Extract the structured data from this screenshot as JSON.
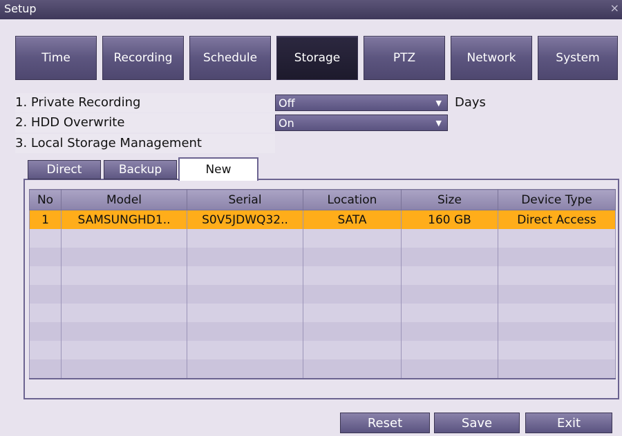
{
  "window": {
    "title": "Setup",
    "close_glyph": "×"
  },
  "tabs": [
    {
      "label": "Time"
    },
    {
      "label": "Recording"
    },
    {
      "label": "Schedule"
    },
    {
      "label": "Storage",
      "active": true
    },
    {
      "label": "PTZ"
    },
    {
      "label": "Network"
    },
    {
      "label": "System"
    }
  ],
  "settings": {
    "private_recording": {
      "label": "1. Private Recording",
      "value": "Off",
      "unit": "Days"
    },
    "hdd_overwrite": {
      "label": "2. HDD Overwrite",
      "value": "On"
    },
    "local_storage": {
      "label": "3. Local Storage Management"
    }
  },
  "subtabs": [
    {
      "label": "Direct"
    },
    {
      "label": "Backup"
    },
    {
      "label": "New",
      "active": true
    }
  ],
  "table": {
    "columns": [
      "No",
      "Model",
      "Serial",
      "Location",
      "Size",
      "Device Type"
    ],
    "rows": [
      {
        "no": "1",
        "model": "SAMSUNGHD1..",
        "serial": "S0V5JDWQ32..",
        "location": "SATA",
        "size": "160 GB",
        "device_type": "Direct Access"
      }
    ],
    "empty_rows": 8
  },
  "buttons": {
    "reset": "Reset",
    "save": "Save",
    "exit": "Exit"
  },
  "colors": {
    "selected_row": "#ffad1a",
    "accent": "#5d5680",
    "active_tab": "#1d1a2c"
  },
  "icons": {
    "dropdown_caret": "chevron-down-icon",
    "close": "close-icon"
  }
}
